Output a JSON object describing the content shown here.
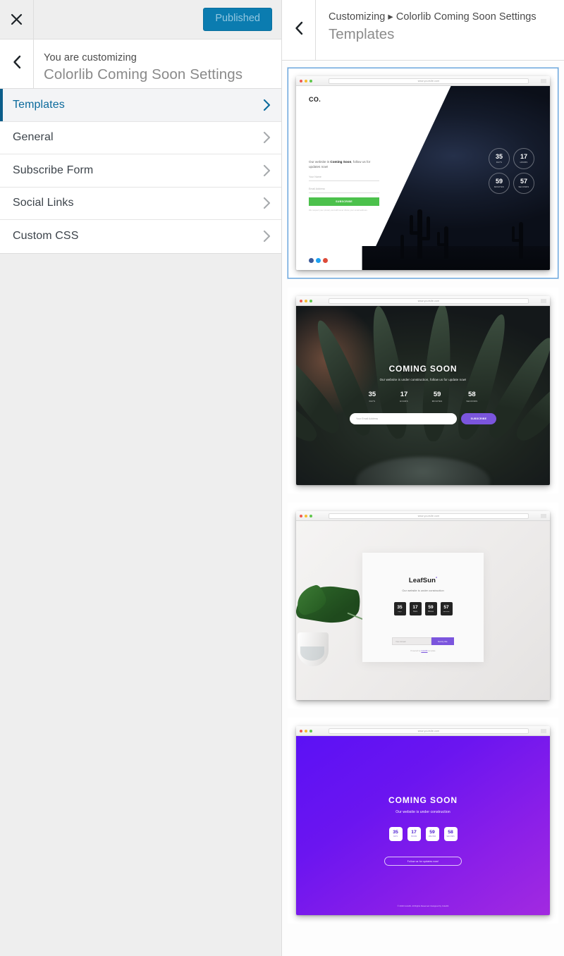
{
  "customizer": {
    "close_icon": "close-icon",
    "publish_label": "Published",
    "back_icon": "chevron-left-icon",
    "eyebrow": "You are customizing",
    "site_title": "Colorlib Coming Soon Settings",
    "sections": [
      {
        "label": "Templates",
        "active": true
      },
      {
        "label": "General",
        "active": false
      },
      {
        "label": "Subscribe Form",
        "active": false
      },
      {
        "label": "Social Links",
        "active": false
      },
      {
        "label": "Custom CSS",
        "active": false
      }
    ]
  },
  "panel": {
    "back_icon": "chevron-left-icon",
    "breadcrumb": "Customizing ▸ Colorlib Coming Soon Settings",
    "title": "Templates"
  },
  "colors": {
    "accent_blue": "#0b7cb0",
    "selected_border": "#5b9dd9",
    "active_bar": "#0b5d8a",
    "green_button": "#4cc14c",
    "purple": "#7b55dd",
    "gradient_start": "#5b11f5",
    "gradient_end": "#a22ae0"
  },
  "templates": [
    {
      "id": "template-1",
      "selected": true,
      "address": "www.yoursite.com",
      "logo": "CO.",
      "tagline_pre": "Our website is ",
      "tagline_bold": "Coming Soon",
      "tagline_post": ", follow us for updates now!",
      "input_name_placeholder": "Your Name",
      "input_email_placeholder": "Email Address",
      "button_label": "SUBSCRIBE",
      "note": "We respect your privacy and will never share your email address.",
      "social": [
        "facebook-icon",
        "twitter-icon",
        "google-plus-icon"
      ],
      "counter": [
        {
          "value": "35",
          "label": "DAYS"
        },
        {
          "value": "17",
          "label": "HOURS"
        },
        {
          "value": "59",
          "label": "MINUTES"
        },
        {
          "value": "57",
          "label": "SECONDS"
        }
      ]
    },
    {
      "id": "template-2",
      "selected": false,
      "address": "www.yoursite.com",
      "heading": "COMING SOON",
      "subheading": "Our website is under construction, follow us for update now!",
      "input_placeholder": "Your Email Address",
      "button_label": "SUBSCRIBE",
      "counter": [
        {
          "value": "35",
          "label": "DAYS"
        },
        {
          "value": "17",
          "label": "HOURS"
        },
        {
          "value": "59",
          "label": "MINUTES"
        },
        {
          "value": "58",
          "label": "SECONDS"
        }
      ]
    },
    {
      "id": "template-3",
      "selected": false,
      "address": "www.yoursite.com",
      "brand": "LeafSun",
      "brand_mark": "*",
      "subheading": "Our website is under construction",
      "input_placeholder": "Your Email",
      "button_label": "Notify Me",
      "note_pre": "Powered by ",
      "note_link": "Colorlib",
      "note_post": " template",
      "counter": [
        {
          "value": "35",
          "label": "Days"
        },
        {
          "value": "17",
          "label": "Hours"
        },
        {
          "value": "59",
          "label": "Minutes"
        },
        {
          "value": "57",
          "label": "Seconds"
        }
      ]
    },
    {
      "id": "template-4",
      "selected": false,
      "address": "www.yoursite.com",
      "heading": "COMING SOON",
      "subheading": "Our website is under construction",
      "button_label": "Follow us for updates now!",
      "footer": "© 2019 Colorlib. All Rights Reserved. Designed by Colorlib",
      "counter": [
        {
          "value": "35",
          "label": "DAYS"
        },
        {
          "value": "17",
          "label": "HOURS"
        },
        {
          "value": "59",
          "label": "MINUTES"
        },
        {
          "value": "58",
          "label": "SECONDS"
        }
      ]
    }
  ]
}
